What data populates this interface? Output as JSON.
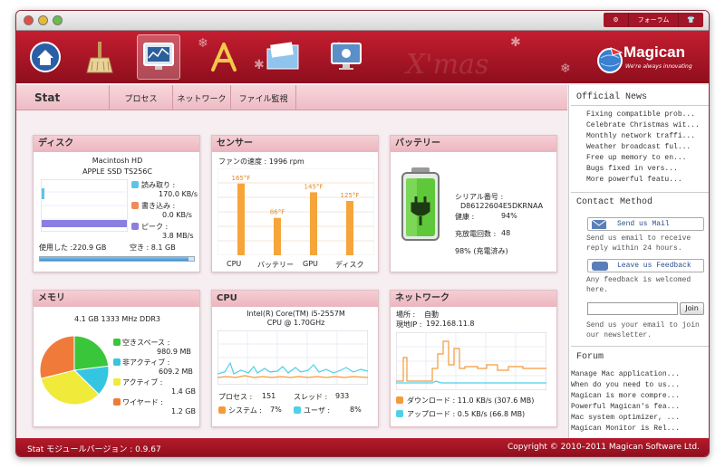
{
  "window": {
    "top_buttons": [
      "⚙",
      "フォーラム",
      "👕"
    ]
  },
  "toolbar": {
    "xmas_text": "X'mas",
    "logo_title": "Magican",
    "logo_sub": "We're always innovating"
  },
  "tabs": {
    "stat": "Stat",
    "items": [
      "プロセス",
      "ネットワーク",
      "ファイル監視"
    ]
  },
  "disk": {
    "title": "ディスク",
    "name": "Macintosh HD",
    "model": "APPLE SSD TS256C",
    "legend": [
      {
        "label": "読み取り :",
        "value": "170.0 KB/s",
        "color": "#5fc3e8"
      },
      {
        "label": "書き込み :",
        "value": "0.0 KB/s",
        "color": "#f08a5a"
      },
      {
        "label": "ピーク :",
        "value": "3.8 MB/s",
        "color": "#8a7fe0"
      }
    ],
    "used": "使用した :220.9 GB",
    "free": "空き : 8.1 GB",
    "used_fraction": 0.965
  },
  "sensor": {
    "title": "センサー",
    "fan": "ファンの速度 : 1996 rpm",
    "bars": [
      {
        "label": "CPU",
        "temp": "165°F",
        "value": 165
      },
      {
        "label": "バッテリー",
        "temp": "86°F",
        "value": 86
      },
      {
        "label": "GPU",
        "temp": "145°F",
        "value": 145
      },
      {
        "label": "ディスク",
        "temp": "125°F",
        "value": 125
      }
    ]
  },
  "battery": {
    "title": "バッテリー",
    "serial_label": "シリアル番号 :",
    "serial": "D86122604E5DKRNAA",
    "health_label": "健康 :",
    "health": "94%",
    "cycles_label": "充放電回数 :",
    "cycles": "48",
    "charge": "98% (充電済み)"
  },
  "memory": {
    "title": "メモリ",
    "spec": "4.1 GB 1333 MHz DDR3",
    "legend": [
      {
        "label": "空きスペース :",
        "value": "980.9 MB",
        "color": "#3ac63a"
      },
      {
        "label": "非アクティブ :",
        "value": "609.2 MB",
        "color": "#34c6e0"
      },
      {
        "label": "アクティブ :",
        "value": "1.4 GB",
        "color": "#f0ea3a"
      },
      {
        "label": "ワイヤード :",
        "value": "1.2 GB",
        "color": "#f07a3a"
      }
    ]
  },
  "cpu": {
    "title": "CPU",
    "model1": "Intel(R) Core(TM) i5-2557M",
    "model2": "CPU @ 1.70GHz",
    "process_label": "プロセス :",
    "process": "151",
    "thread_label": "スレッド :",
    "thread": "933",
    "system_label": "システム :",
    "system": "7%",
    "user_label": "ユーザ :",
    "user": "8%",
    "system_color": "#f59a3a",
    "user_color": "#4fd0e8"
  },
  "network": {
    "title": "ネットワーク",
    "location_label": "場所 :",
    "location": "自動",
    "ip_label": "現地IP :",
    "ip": "192.168.11.8",
    "download": "ダウンロード : 11.0 KB/s (307.6 MB)",
    "upload": "アップロード : 0.5 KB/s (66.8 MB)",
    "download_color": "#f59a3a",
    "upload_color": "#4fd0e8"
  },
  "sidebar": {
    "news_title": "Official News",
    "news": [
      "Fixing compatible prob...",
      "Celebrate Christmas wit...",
      "Monthly network traffi...",
      "Weather broadcast ful...",
      "Free up memory to en...",
      "Bugs fixed in vers...",
      "More powerful featu..."
    ],
    "contact_title": "Contact Method",
    "mail_btn": "Send us Mail",
    "mail_text": [
      "Send us email to receive",
      "reply within 24 hours."
    ],
    "feedback_btn": "Leave us Feedback",
    "feedback_text": [
      "Any feedback is welcomed",
      "here."
    ],
    "email_placeholder": "",
    "join_btn": "Join",
    "join_text": [
      "Send us your email to join",
      "our newsletter."
    ],
    "forum_title": "Forum",
    "forum": [
      "Manage Mac application...",
      "When do you need to us...",
      "Magican is more compre...",
      "Powerful Magican's fea...",
      "Mac system optimizer, ...",
      "Magican Monitor is Rel..."
    ]
  },
  "status": {
    "version": "Stat モジュールバージョン : 0.9.67",
    "copyright": "Copyright © 2010–2011 Magican Software Ltd."
  }
}
